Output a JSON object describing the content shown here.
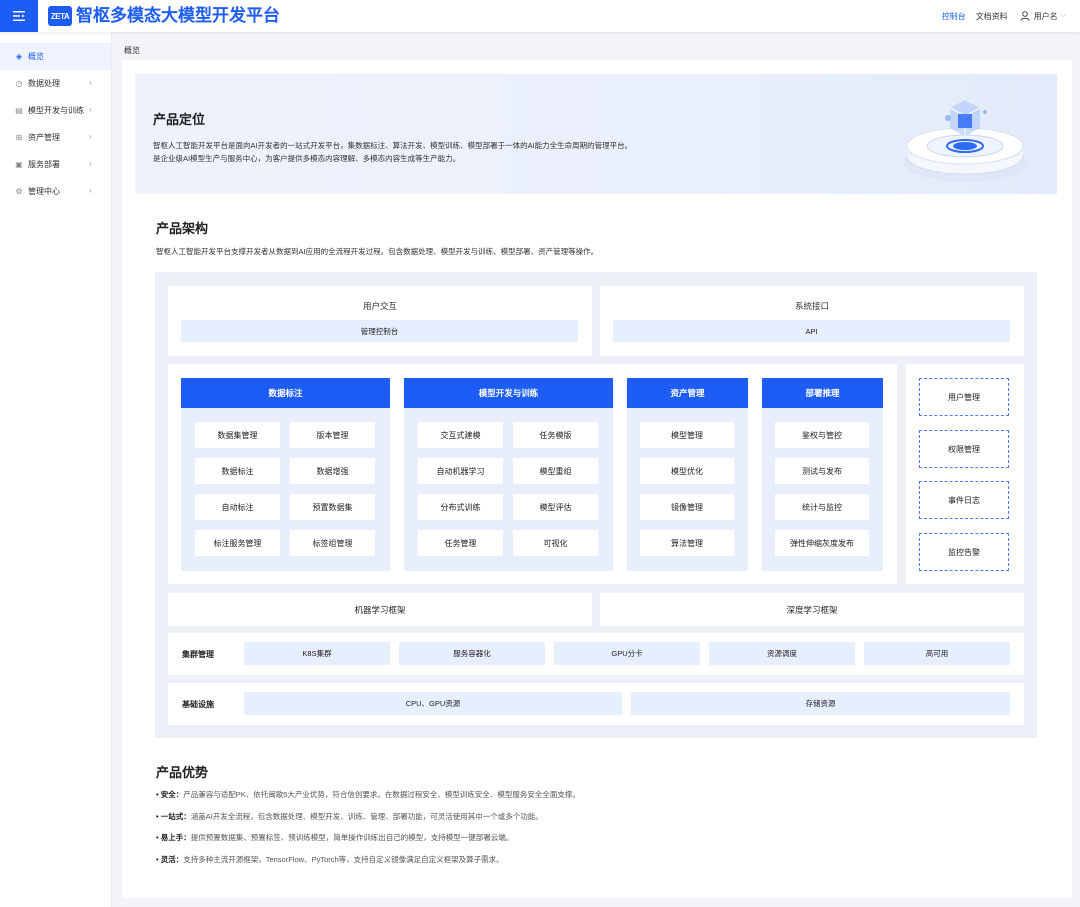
{
  "app": {
    "logo_text": "ZETA",
    "title": "智枢多模态大模型开发平台"
  },
  "header": {
    "links": [
      "控制台",
      "文档资料"
    ],
    "active_link": "控制台",
    "username": "用户名"
  },
  "sidebar": {
    "items": [
      {
        "label": "概览",
        "icon": "layers-icon",
        "active": true
      },
      {
        "label": "数据处理",
        "icon": "clock-icon"
      },
      {
        "label": "模型开发与训练",
        "icon": "model-icon"
      },
      {
        "label": "资产管理",
        "icon": "grid-icon"
      },
      {
        "label": "服务部署",
        "icon": "server-icon"
      },
      {
        "label": "管理中心",
        "icon": "gear-icon"
      }
    ]
  },
  "breadcrumb": "概览",
  "positioning": {
    "title": "产品定位",
    "lines": [
      "智枢人工智能开发平台是面向AI开发者的一站式开发平台，集数据标注、算法开发、模型训练、模型部署于一体的AI能力全生命周期的管理平台。",
      "是企业级AI模型生产与服务中心，为客户提供多模态内容理解、多模态内容生成等生产能力。"
    ]
  },
  "architecture": {
    "title": "产品架构",
    "desc": "智枢人工智能开发平台支撑开发者从数据到AI应用的全流程开发过程。包含数据处理、模型开发与训练、模型部署、资产管理等操作。",
    "user_interaction": {
      "title": "用户交互",
      "item": "管理控制台"
    },
    "system_interface": {
      "title": "系统接口",
      "item": "API"
    },
    "columns": [
      {
        "title": "数据标注",
        "items": [
          "数据集管理",
          "版本管理",
          "数据标注",
          "数据增强",
          "自动标注",
          "预置数据集",
          "标注服务管理",
          "标签组管理"
        ]
      },
      {
        "title": "模型开发与训练",
        "items": [
          "交互式建模",
          "任务模版",
          "自动机器学习",
          "模型重组",
          "分布式训练",
          "模型评估",
          "任务管理",
          "可视化"
        ]
      },
      {
        "title": "资产管理",
        "items": [
          "模型管理",
          "模型优化",
          "镜像管理",
          "算法管理"
        ]
      },
      {
        "title": "部署推理",
        "items": [
          "鉴权与管控",
          "测试与发布",
          "统计与监控",
          "弹性伸缩灰度发布"
        ]
      }
    ],
    "management": [
      "用户管理",
      "权限管理",
      "事件日志",
      "监控告警"
    ],
    "frameworks": [
      "机器学习框架",
      "深度学习框架"
    ],
    "cluster": {
      "label": "集群管理",
      "items": [
        "K8S集群",
        "服务容器化",
        "GPU分卡",
        "资源调度",
        "高可用"
      ]
    },
    "infra": {
      "label": "基础设施",
      "items": [
        "CPU、GPU资源",
        "存储资源"
      ]
    }
  },
  "advantages": {
    "title": "产品优势",
    "items": [
      {
        "label": "• 安全：",
        "text": "产品兼容与适配PK、依托闽歌5大产业优势，符合信创要求。在数据过程安全、模型训练安全、模型服务安全全面支撑。"
      },
      {
        "label": "• 一站式：",
        "text": "涵盖AI开发全流程，包含数据处理、模型开发、训练、管理、部署功能，可灵活使用其中一个或多个功能。"
      },
      {
        "label": "• 易上手：",
        "text": "提供预置数据集、预置标签、预训练模型，简单操作训练出自己的模型，支持模型一键部署云端。"
      },
      {
        "label": "• 灵活：",
        "text": "支持多种主流开源框架，TensorFlow、PyTorch等，支持自定义镜像满足自定义框架及算子需求。"
      }
    ]
  },
  "colors": {
    "brand": "#1d5cf5",
    "pill": "#e7eefd",
    "arch_bg": "#edf0f6"
  }
}
